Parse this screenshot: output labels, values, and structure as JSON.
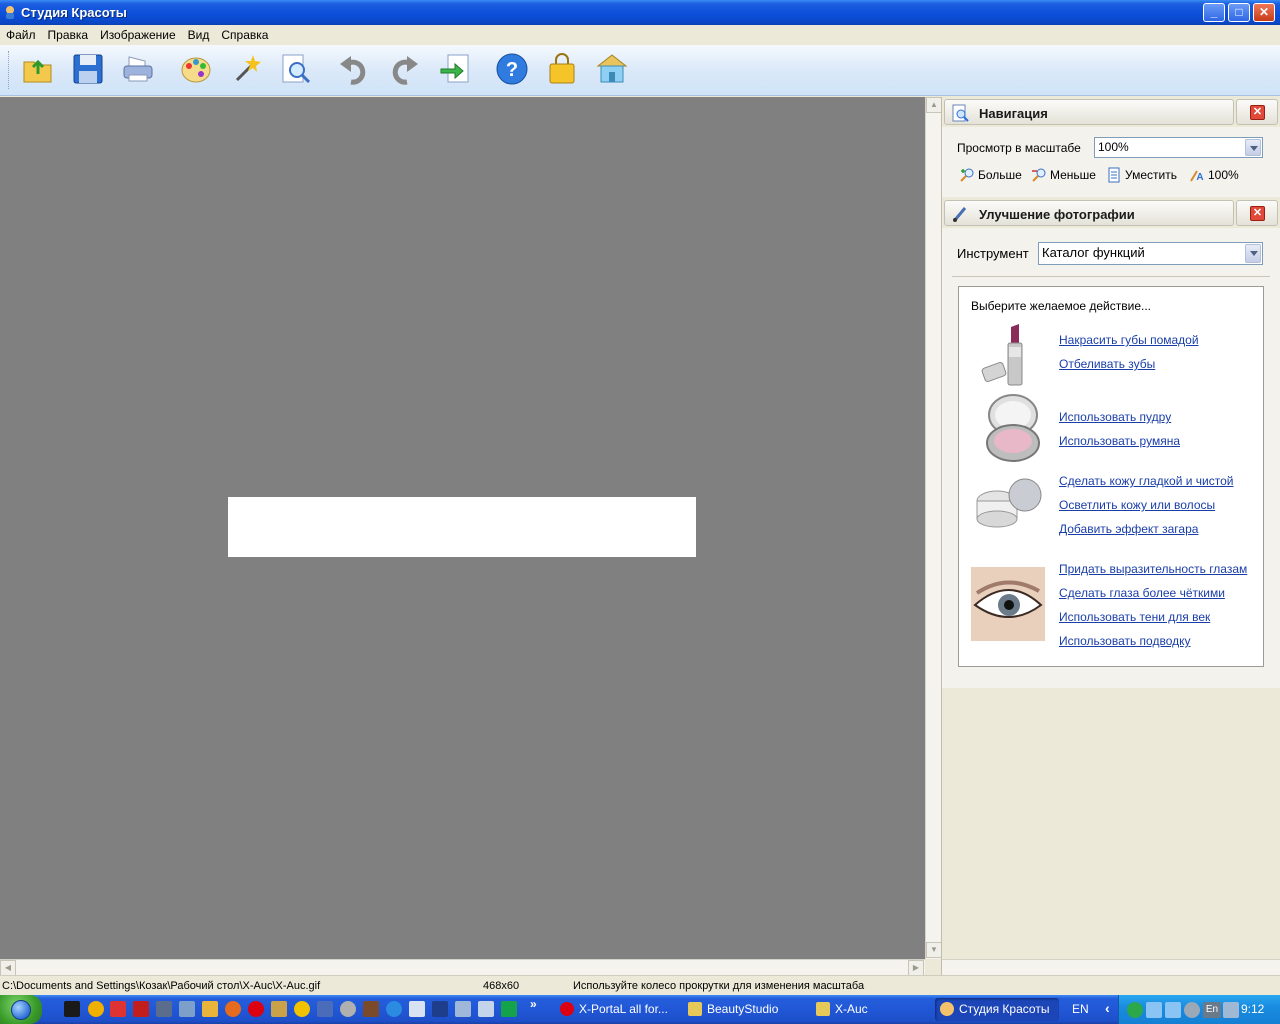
{
  "window": {
    "title": "Студия Красоты"
  },
  "menu": [
    "Файл",
    "Правка",
    "Изображение",
    "Вид",
    "Справка"
  ],
  "toolbar": {
    "icons": [
      "open-folder-icon",
      "save-icon",
      "print-icon",
      "palette-icon",
      "magic-wand-icon",
      "zoom-icon",
      "undo-icon",
      "redo-icon",
      "export-icon",
      "help-icon",
      "shopping-bag-icon",
      "home-icon"
    ]
  },
  "navigation_panel": {
    "title": "Навигация",
    "zoom_label": "Просмотр в масштабе",
    "zoom_value": "100%",
    "buttons": [
      "Больше",
      "Меньше",
      "Уместить",
      "100%"
    ]
  },
  "enhance_panel": {
    "title": "Улучшение фотографии",
    "tool_label": "Инструмент",
    "tool_value": "Каталог функций",
    "prompt": "Выберите желаемое действие...",
    "groups": [
      {
        "thumb": "lipstick-icon",
        "links": [
          "Накрасить губы помадой",
          "Отбеливать зубы"
        ]
      },
      {
        "thumb": "powder-compact-icon",
        "links": [
          "Использовать пудру",
          "Использовать румяна"
        ]
      },
      {
        "thumb": "cream-jar-icon",
        "links": [
          "Сделать кожу гладкой и чистой",
          "Осветлить кожу или волосы",
          "Добавить эффект загара"
        ]
      },
      {
        "thumb": "eye-icon",
        "links": [
          "Придать выразительность глазам",
          "Сделать глаза более чёткими",
          "Использовать тени для век",
          "Использовать подводку"
        ]
      }
    ]
  },
  "statusbar": {
    "path": "C:\\Documents and Settings\\Козак\\Рабочий стол\\X-Auc\\X-Auc.gif",
    "dimensions": "468x60",
    "hint": "Используйте колесо прокрутки для изменения масштаба"
  },
  "taskbar": {
    "more": "»",
    "tasks": [
      "X-PortaL all for...",
      "BeautyStudio",
      "X-Auc",
      "Студия Красоты"
    ],
    "lang": "EN",
    "tray_lang": "En",
    "clock": "9:12"
  },
  "colors": {
    "canvas": "#808080",
    "link": "#1a3ea8",
    "titlebar": "#0b4ed8",
    "close": "#e14a3a"
  }
}
